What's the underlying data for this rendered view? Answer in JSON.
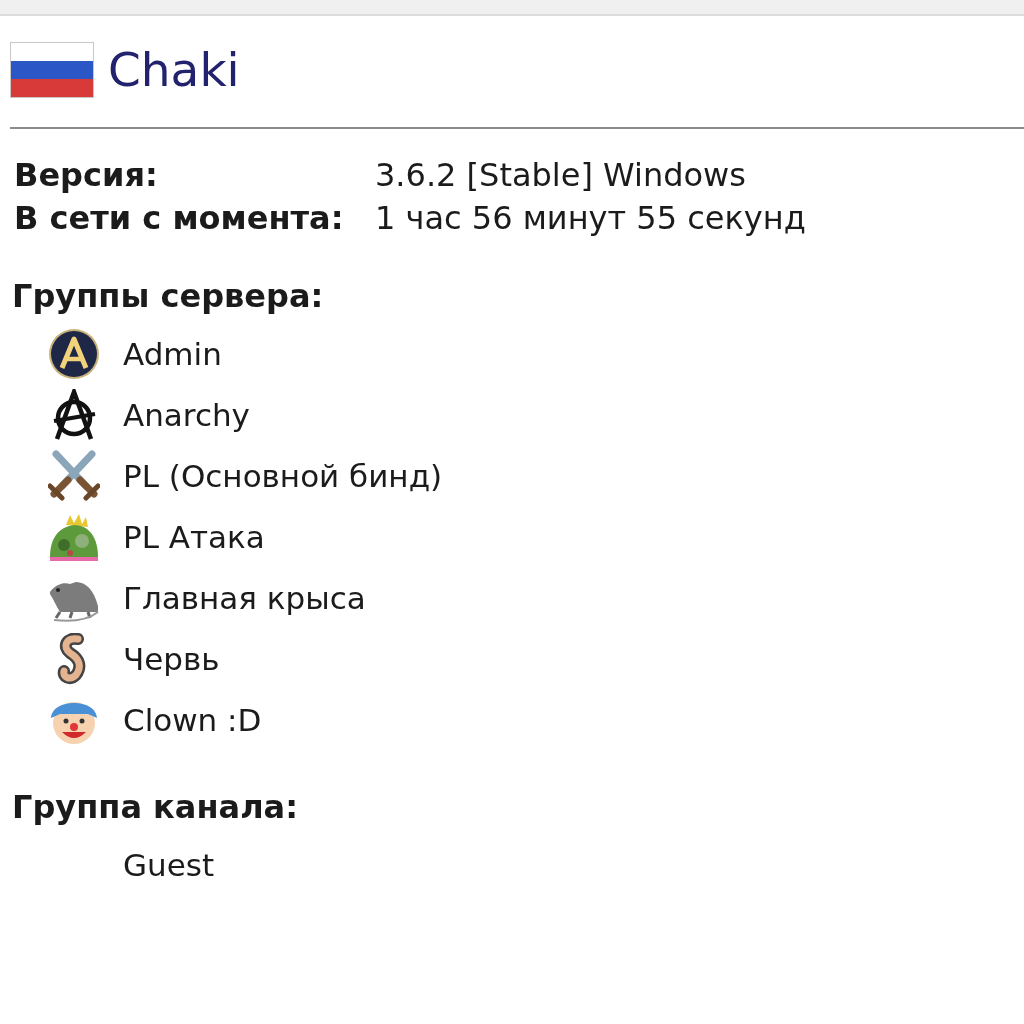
{
  "client": {
    "nickname": "Chaki"
  },
  "info": [
    {
      "label": "Версия:",
      "value": "3.6.2 [Stable] Windows"
    },
    {
      "label": "В сети с момента:",
      "value": "1 час 56 минут 55 секунд"
    }
  ],
  "server_groups": {
    "heading": "Группы сервера:",
    "items": [
      {
        "name": "Admin"
      },
      {
        "name": "Anarchy"
      },
      {
        "name": "PL (Основной бинд)"
      },
      {
        "name": "PL Атака"
      },
      {
        "name": "Главная крыса"
      },
      {
        "name": "Червь"
      },
      {
        "name": "Clown :D"
      }
    ]
  },
  "channel_group": {
    "heading": "Группа канала:",
    "items": [
      {
        "name": "Guest"
      }
    ]
  }
}
